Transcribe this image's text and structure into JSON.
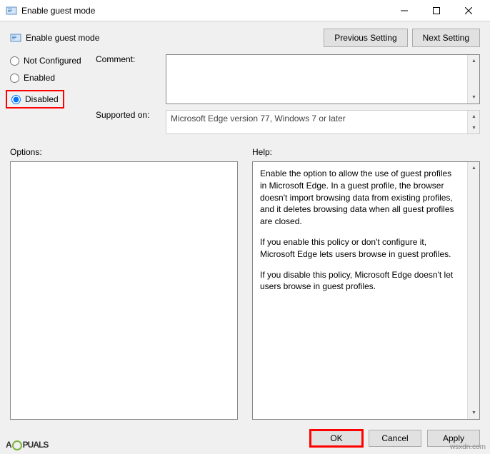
{
  "window": {
    "title": "Enable guest mode"
  },
  "header": {
    "policy_name": "Enable guest mode",
    "prev_setting": "Previous Setting",
    "next_setting": "Next Setting"
  },
  "radios": {
    "not_configured": "Not Configured",
    "enabled": "Enabled",
    "disabled": "Disabled",
    "selected": "disabled"
  },
  "fields": {
    "comment_label": "Comment:",
    "comment_value": "",
    "supported_label": "Supported on:",
    "supported_value": "Microsoft Edge version 77, Windows 7 or later"
  },
  "panels": {
    "options_label": "Options:",
    "help_label": "Help:",
    "help_p1": "Enable the option to allow the use of guest profiles in Microsoft Edge. In a guest profile, the browser doesn't import browsing data from existing profiles, and it deletes browsing data when all guest profiles are closed.",
    "help_p2": "If you enable this policy or don't configure it, Microsoft Edge lets users browse in guest profiles.",
    "help_p3": "If you disable this policy, Microsoft Edge doesn't let users browse in guest profiles."
  },
  "footer": {
    "ok": "OK",
    "cancel": "Cancel",
    "apply": "Apply"
  },
  "watermark": "wsxdn.com"
}
